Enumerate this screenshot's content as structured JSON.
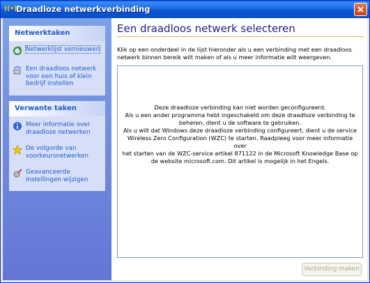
{
  "window": {
    "title": "Draadloze netwerkverbinding"
  },
  "sidebar": {
    "network_tasks": {
      "title": "Netwerktaken",
      "items": [
        {
          "label": "Netwerklijst vernieuwen",
          "icon": "refresh-icon",
          "selected": true
        },
        {
          "label": "Een draadloos netwerk voor een huis of klein bedrijf instellen",
          "icon": "setup-network-icon"
        }
      ]
    },
    "related_tasks": {
      "title": "Verwante taken",
      "items": [
        {
          "label": "Meer informatie over draadloze netwerken",
          "icon": "info-icon"
        },
        {
          "label": "De volgorde van voorkeursnetwerken",
          "icon": "star-icon"
        },
        {
          "label": "Geavanceerde instellingen wijzigen",
          "icon": "settings-icon"
        }
      ]
    }
  },
  "main": {
    "title": "Een draadloos netwerk selecteren",
    "intro": "Klik op een onderdeel in de lijst hieronder als u een verbinding met een draadloos netwerk binnen bereik wilt maken of als u meer informatie wilt weergeven.",
    "message_lines": [
      "Deze draadloze verbinding kan niet worden geconfigureerd.",
      "Als u een ander programma hebt ingeschakeld om deze draadloze verbinding te",
      "beheren, dient u de software te gebruiken.",
      "Als u wilt dat Windows deze draadloze verbinding configureert, dient u de service",
      "Wireless Zero Configuration (WZC) te starten. Raadpleeg voor meer informatie over",
      "het starten van de WZC-service artikel 871122 in de Microsoft Knowledge Base op",
      "de website microsoft.com. Dit artikel is mogelijk in het Engels."
    ],
    "connect_button": "Verbinding maken"
  },
  "colors": {
    "accent": "#215dc6",
    "titlebar": "#0a5fd8",
    "sidebar": "#6375d6",
    "divider": "#f0b450"
  }
}
